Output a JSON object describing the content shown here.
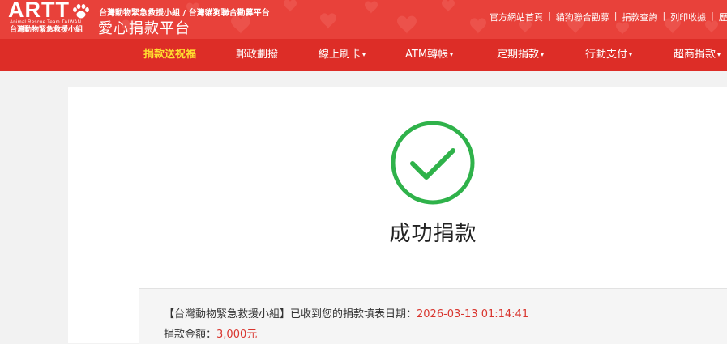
{
  "header": {
    "logo_text": "ARTT",
    "logo_sub_en": "Animal Rescue Team TAIWAN",
    "logo_sub_zh": "台灣動物緊急救援小組",
    "org_line": "台灣動物緊急救援小組 / 台灣貓狗聯合勸募平台",
    "platform_title": "愛心捐款平台",
    "top_links": [
      "官方網站首頁",
      "貓狗聯合勸募",
      "捐款查詢",
      "列印收據",
      "歷"
    ]
  },
  "nav": {
    "items": [
      {
        "label": "捐款送祝福",
        "active": true,
        "dropdown": false
      },
      {
        "label": "郵政劃撥",
        "active": false,
        "dropdown": false
      },
      {
        "label": "線上刷卡",
        "active": false,
        "dropdown": true
      },
      {
        "label": "ATM轉帳",
        "active": false,
        "dropdown": true
      },
      {
        "label": "定期捐款",
        "active": false,
        "dropdown": true
      },
      {
        "label": "行動支付",
        "active": false,
        "dropdown": true
      },
      {
        "label": "超商捐款",
        "active": false,
        "dropdown": true
      }
    ],
    "caret": "▾"
  },
  "result": {
    "title": "成功捐款",
    "message_prefix": "【台灣動物緊急救援小組】已收到您的捐款填表日期：",
    "date": "2026-03-13 01:14:41",
    "amount_label": "捐款金額：",
    "amount": "3,000元"
  },
  "colors": {
    "header_red": "#e8413a",
    "nav_red": "#dd2d27",
    "active_yellow": "#ffde2f",
    "success_green": "#2fb24a",
    "value_red": "#d9362f"
  },
  "icons": {
    "success": "check-circle-icon",
    "paw": "paw-icon",
    "dropdown": "caret-down-icon"
  }
}
